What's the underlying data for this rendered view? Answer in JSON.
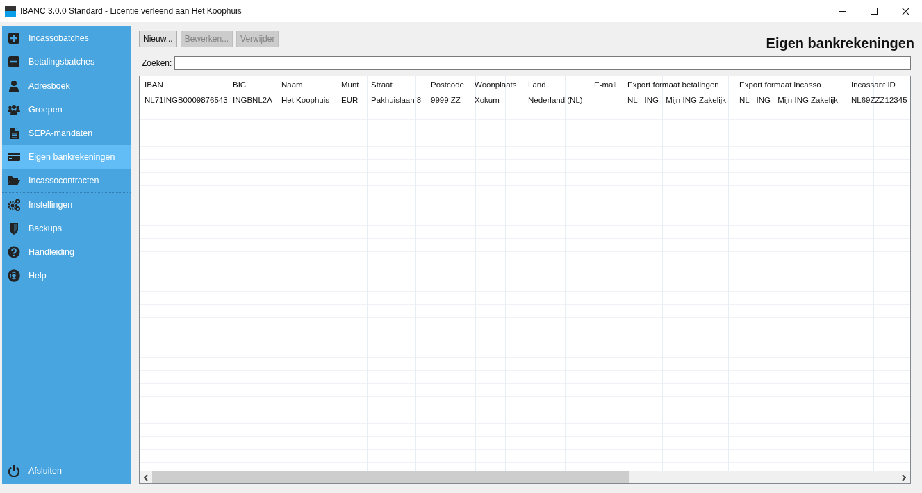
{
  "window": {
    "title": "IBANC 3.0.0 Standard - Licentie verleend aan Het Koophuis"
  },
  "sidebar": {
    "groups": [
      {
        "items": [
          {
            "label": "Incassobatches",
            "selected": false
          },
          {
            "label": "Betalingsbatches",
            "selected": false
          }
        ]
      },
      {
        "items": [
          {
            "label": "Adresboek",
            "selected": false
          },
          {
            "label": "Groepen",
            "selected": false
          },
          {
            "label": "SEPA-mandaten",
            "selected": false
          },
          {
            "label": "Eigen bankrekeningen",
            "selected": true
          },
          {
            "label": "Incassocontracten",
            "selected": false
          }
        ]
      },
      {
        "items": [
          {
            "label": "Instellingen",
            "selected": false
          },
          {
            "label": "Backups",
            "selected": false
          },
          {
            "label": "Handleiding",
            "selected": false
          },
          {
            "label": "Help",
            "selected": false
          }
        ]
      }
    ],
    "footer": {
      "label": "Afsluiten"
    }
  },
  "toolbar": {
    "buttons": [
      {
        "label": "Nieuw...",
        "disabled": false
      },
      {
        "label": "Bewerken...",
        "disabled": true
      },
      {
        "label": "Verwijder",
        "disabled": true
      }
    ]
  },
  "page_title": "Eigen bankrekeningen",
  "search": {
    "label": "Zoeken:"
  },
  "table": {
    "columns": [
      "IBAN",
      "BIC",
      "Naam",
      "Munt",
      "Straat",
      "Postcode",
      "Woonplaats",
      "Land",
      "E-mail",
      "Export formaat betalingen",
      "Export formaat incasso",
      "Incassant ID"
    ],
    "rows": [
      [
        "NL71INGB0009876543",
        "INGBNL2A",
        "Het Koophuis",
        "EUR",
        "Pakhuislaan 8",
        "9999 ZZ",
        "Xokum",
        "Nederland (NL)",
        null,
        "NL - ING - Mijn ING Zakelijk",
        "NL - ING - Mijn ING Zakelijk",
        "NL69ZZZ12345"
      ]
    ]
  }
}
